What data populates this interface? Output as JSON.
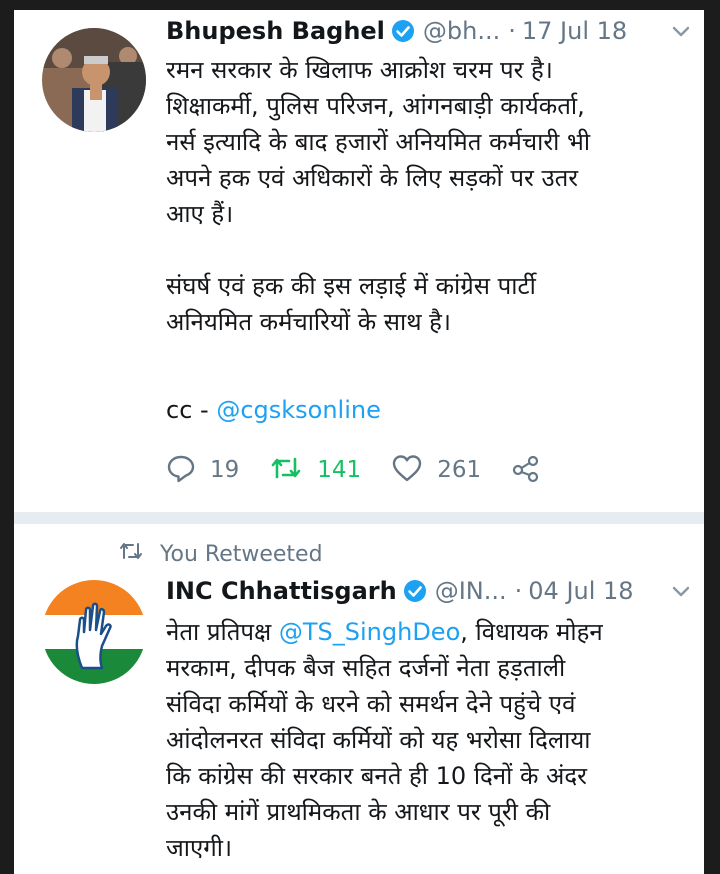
{
  "tweet1": {
    "name": "Bhupesh Baghel",
    "handle": "@bh...",
    "separator": "·",
    "date": "17 Jul 18",
    "text": "रमन सरकार के खिलाफ आक्रोश चरम पर है।\nशिक्षाकर्मी, पुलिस परिजन, आंगनबाड़ी कार्यकर्ता,\nनर्स इत्यादि के बाद हजारों अनियमित कर्मचारी भी\nअपने हक एवं अधिकारों के लिए सड़कों पर उतर\nआए हैं।\n\nसंघर्ष एवं हक की इस लड़ाई में कांग्रेस पार्टी\nअनियमित कर्मचारियों के साथ है।",
    "cc_prefix": "cc - ",
    "cc_mention": "@cgsksonline",
    "replies": "19",
    "retweets": "141",
    "likes": "261"
  },
  "tweet2": {
    "retweet_label": "You Retweeted",
    "name": "INC Chhattisgarh",
    "handle": "@IN...",
    "separator": "·",
    "date": "04 Jul 18",
    "text_pre": "नेता प्रतिपक्ष ",
    "mention": "@TS_SinghDeo",
    "text_post": ", विधायक मोहन\nमरकाम, दीपक बैज सहित दर्जनों नेता हड़ताली\nसंविदा कर्मियों के धरने को समर्थन देने पहुंचे एवं\nआंदोलनरत संविदा कर्मियों को यह भरोसा दिलाया\nकि कांग्रेस की सरकार बनते ही 10 दिनों के अंदर\nउनकी मांगें प्राथमिकता के आधार पर पूरी की\nजाएगी।"
  },
  "icons": {
    "verified": "verified-badge-icon",
    "caret": "chevron-down-icon",
    "reply": "reply-icon",
    "retweet": "retweet-icon",
    "like": "heart-icon",
    "share": "share-icon"
  },
  "colors": {
    "text": "#14171a",
    "secondary": "#657786",
    "link": "#1da1f2",
    "retweet_active": "#17bf63",
    "background": "#ffffff"
  }
}
